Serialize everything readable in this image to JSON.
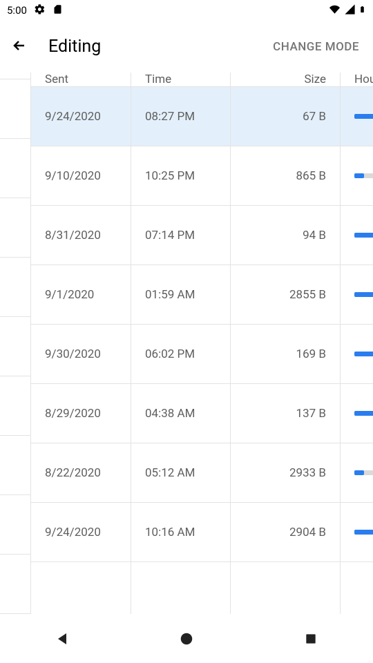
{
  "status": {
    "time": "5:00"
  },
  "appbar": {
    "title": "Editing",
    "change_mode": "CHANGE MODE"
  },
  "headers": {
    "sent": "Sent",
    "time": "Time",
    "size": "Size",
    "hou": "Hou"
  },
  "rows": [
    {
      "sent": "9/24/2020",
      "time": "08:27 PM",
      "size": "67 B",
      "bar": 100,
      "selected": true
    },
    {
      "sent": "9/10/2020",
      "time": "10:25 PM",
      "size": "865 B",
      "bar": 35,
      "selected": false
    },
    {
      "sent": "8/31/2020",
      "time": "07:14 PM",
      "size": "94 B",
      "bar": 100,
      "selected": false
    },
    {
      "sent": "9/1/2020",
      "time": "01:59 AM",
      "size": "2855 B",
      "bar": 100,
      "selected": false
    },
    {
      "sent": "9/30/2020",
      "time": "06:02 PM",
      "size": "169 B",
      "bar": 100,
      "selected": false
    },
    {
      "sent": "8/29/2020",
      "time": "04:38 AM",
      "size": "137 B",
      "bar": 100,
      "selected": false
    },
    {
      "sent": "8/22/2020",
      "time": "05:12 AM",
      "size": "2933 B",
      "bar": 35,
      "selected": false
    },
    {
      "sent": "9/24/2020",
      "time": "10:16 AM",
      "size": "2904 B",
      "bar": 100,
      "selected": false
    },
    {
      "sent": "",
      "time": "",
      "size": "",
      "bar": 0,
      "selected": false
    }
  ]
}
